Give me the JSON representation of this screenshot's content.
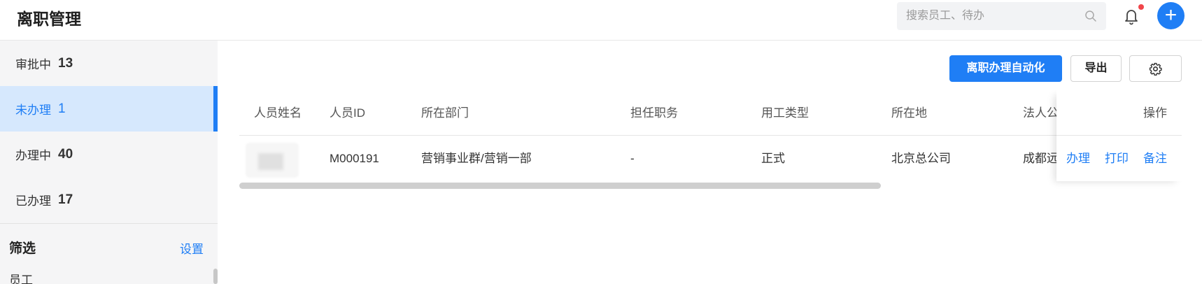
{
  "header": {
    "title": "离职管理",
    "search": {
      "placeholder": "搜索员工、待办",
      "icon": "search-icon"
    },
    "notification_icon": "bell-icon",
    "add_label": "+"
  },
  "sidebar": {
    "items": [
      {
        "label": "审批中",
        "count": "13"
      },
      {
        "label": "未办理",
        "count": "1",
        "selected": true
      },
      {
        "label": "办理中",
        "count": "40"
      },
      {
        "label": "已办理",
        "count": "17"
      }
    ],
    "filter": {
      "title": "筛选",
      "settings": "设置",
      "items": [
        "员工"
      ]
    }
  },
  "toolbar": {
    "automation_label": "离职办理自动化",
    "export_label": "导出",
    "settings_icon": "gear-icon"
  },
  "table": {
    "columns": [
      "人员姓名",
      "人员ID",
      "所在部门",
      "担任职务",
      "用工类型",
      "所在地",
      "法人公"
    ],
    "action_header": "操作",
    "rows": [
      {
        "id": "M000191",
        "department": "营销事业群/营销一部",
        "position": "-",
        "employment_type": "正式",
        "location": "北京总公司",
        "legal_entity": "成都远",
        "actions": [
          "办理",
          "打印",
          "备注"
        ]
      }
    ]
  },
  "colors": {
    "accent": "#1f7ef5",
    "sidebar_bg": "#f5f5f6",
    "selected_bg": "#d6e8fd",
    "notification_dot": "#f0454a"
  }
}
